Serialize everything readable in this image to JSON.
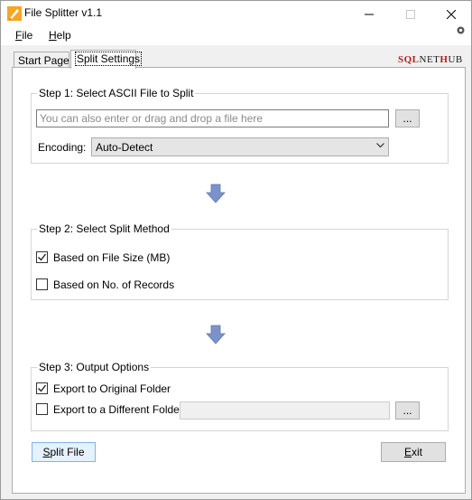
{
  "window": {
    "title": "File Splitter v1.1"
  },
  "menu": {
    "file_label_first": "F",
    "file_label_rest": "ile",
    "help_label_first": "H",
    "help_label_rest": "elp"
  },
  "logo": {
    "part1": "SQL",
    "part2": "NET",
    "part3": "H",
    "part4": "UB"
  },
  "tabs": [
    {
      "label": "Start Page"
    },
    {
      "label": "Split Settings"
    }
  ],
  "step1": {
    "title": "Step 1: Select ASCII File to Split",
    "file_placeholder": "You can also enter or drag and drop a file here",
    "browse_label": "...",
    "encoding_label": "Encoding:",
    "encoding_value": "Auto-Detect"
  },
  "step2": {
    "title": "Step 2: Select Split Method",
    "options": [
      {
        "label": "Based on File Size (MB)",
        "checked": true
      },
      {
        "label": "Based on No. of Records",
        "checked": false
      }
    ]
  },
  "step3": {
    "title": "Step 3: Output Options",
    "options": [
      {
        "label": "Export to Original Folder",
        "checked": true
      },
      {
        "label": "Export to a Different Folder",
        "checked": false
      }
    ],
    "browse_label": "..."
  },
  "buttons": {
    "split_first": "S",
    "split_rest": "plit File",
    "exit_first": "E",
    "exit_rest": "xit"
  },
  "colors": {
    "arrow": "#7b93c9",
    "accent_border": "#7eb4ea",
    "logo_red": "#b41e1e"
  }
}
